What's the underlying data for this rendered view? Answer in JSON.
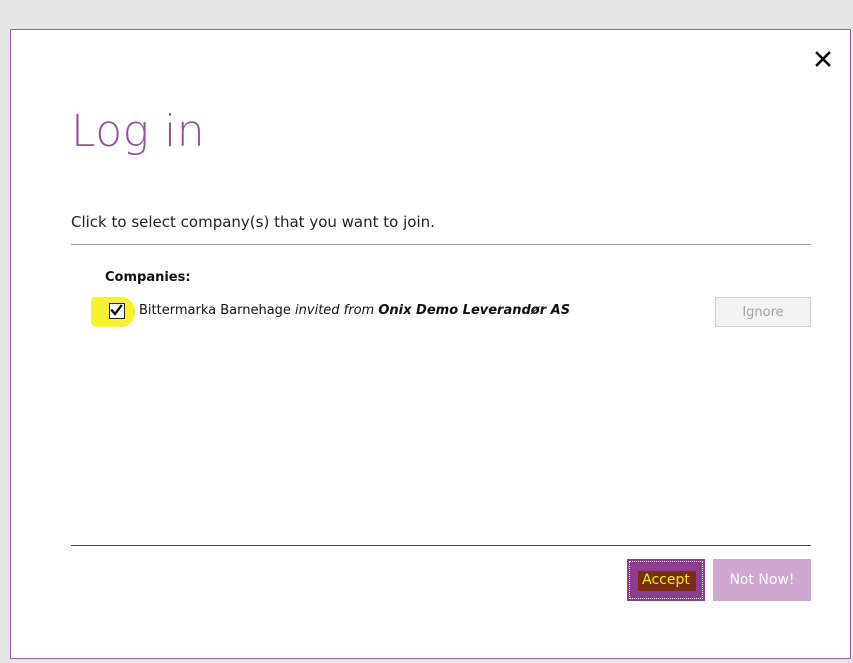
{
  "dialog": {
    "title": "Log in",
    "instruction": "Click to select company(s) that you want to join.",
    "companies_label": "Companies:",
    "close_icon": "close-icon"
  },
  "companies": [
    {
      "name": "Bittermarka Barnehage",
      "invited_from_label": "invited from",
      "supplier": "Onix Demo Leverandør AS",
      "checked": true,
      "ignore_label": "Ignore"
    }
  ],
  "actions": {
    "accept_label": "Accept",
    "not_now_label": "Not Now!"
  },
  "colors": {
    "accent": "#9a4d9f",
    "accept_bg": "#8e3b92",
    "notnow_bg": "#cfa8d2",
    "highlight": "#f7f230"
  }
}
